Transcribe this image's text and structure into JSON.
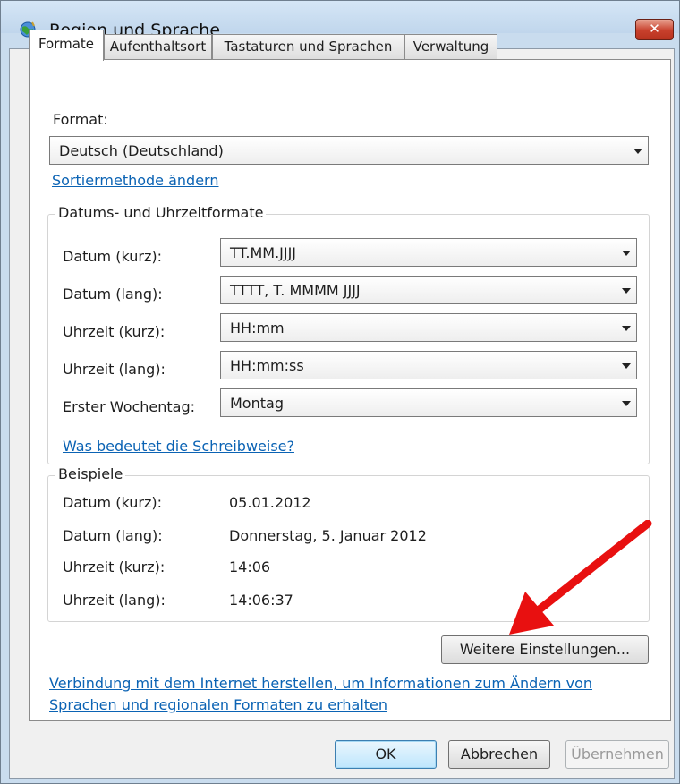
{
  "window": {
    "title": "Region und Sprache",
    "close_label": "✕"
  },
  "tabs": [
    {
      "label": "Formate",
      "active": true
    },
    {
      "label": "Aufenthaltsort",
      "active": false
    },
    {
      "label": "Tastaturen und Sprachen",
      "active": false
    },
    {
      "label": "Verwaltung",
      "active": false
    }
  ],
  "format": {
    "label": "Format:",
    "value": "Deutsch (Deutschland)",
    "sort_link": "Sortiermethode ändern"
  },
  "date_time_formats": {
    "legend": "Datums- und Uhrzeitformate",
    "rows": [
      {
        "label": "Datum (kurz):",
        "value": "TT.MM.JJJJ"
      },
      {
        "label": "Datum (lang):",
        "value": "TTTT, T. MMMM JJJJ"
      },
      {
        "label": "Uhrzeit (kurz):",
        "value": "HH:mm"
      },
      {
        "label": "Uhrzeit (lang):",
        "value": "HH:mm:ss"
      },
      {
        "label": "Erster Wochentag:",
        "value": "Montag"
      }
    ],
    "notation_link": "Was bedeutet die Schreibweise?"
  },
  "examples": {
    "legend": "Beispiele",
    "rows": [
      {
        "label": "Datum (kurz):",
        "value": "05.01.2012"
      },
      {
        "label": "Datum (lang):",
        "value": "Donnerstag, 5. Januar 2012"
      },
      {
        "label": "Uhrzeit (kurz):",
        "value": "14:06"
      },
      {
        "label": "Uhrzeit (lang):",
        "value": "14:06:37"
      }
    ]
  },
  "more_settings_button": "Weitere Einstellungen...",
  "internet_link_line1": "Verbindung mit dem Internet herstellen, um Informationen zum Ändern von",
  "internet_link_line2": "Sprachen und regionalen Formaten zu erhalten",
  "buttons": {
    "ok": "OK",
    "cancel": "Abbrechen",
    "apply": "Übernehmen"
  },
  "colors": {
    "annotation_arrow": "#e81010",
    "link": "#0b63b4"
  }
}
